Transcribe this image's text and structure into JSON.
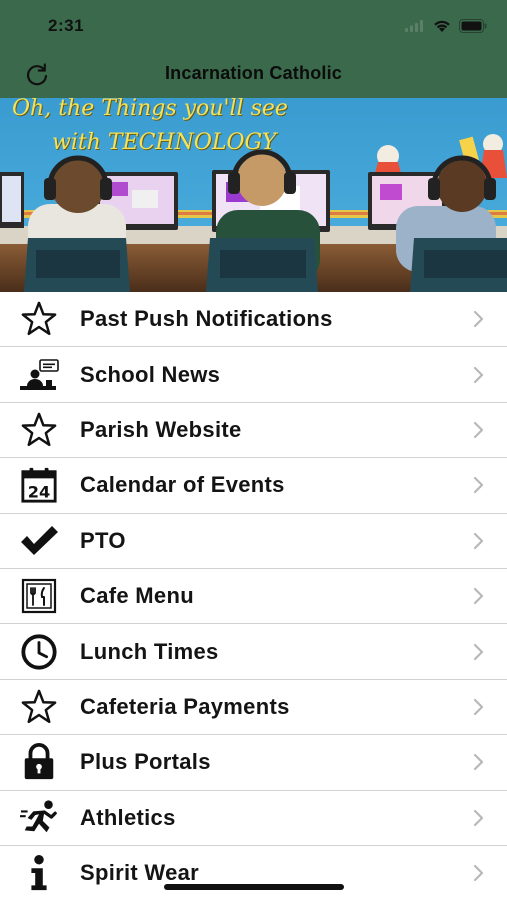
{
  "status_bar": {
    "time": "2:31"
  },
  "nav": {
    "title": "Incarnation Catholic"
  },
  "banner": {
    "line1": "Oh, the Things  you'll see",
    "line2": "with TECHNOLOGY"
  },
  "menu": [
    {
      "label": "Past Push Notifications",
      "icon": "star-outline-icon"
    },
    {
      "label": "School News",
      "icon": "news-icon"
    },
    {
      "label": "Parish Website",
      "icon": "star-outline-icon"
    },
    {
      "label": "Calendar of Events",
      "icon": "calendar-icon",
      "icon_text": "24"
    },
    {
      "label": "PTO",
      "icon": "checkmark-icon"
    },
    {
      "label": "Cafe Menu",
      "icon": "menu-card-icon"
    },
    {
      "label": "Lunch Times",
      "icon": "clock-icon"
    },
    {
      "label": "Cafeteria Payments",
      "icon": "star-outline-icon"
    },
    {
      "label": "Plus Portals",
      "icon": "lock-icon"
    },
    {
      "label": "Athletics",
      "icon": "runner-icon"
    },
    {
      "label": "Spirit Wear",
      "icon": "info-icon"
    }
  ],
  "colors": {
    "header": "#3a6a4b",
    "divider": "#d2d2d2",
    "chevron": "#b8b8bc"
  }
}
